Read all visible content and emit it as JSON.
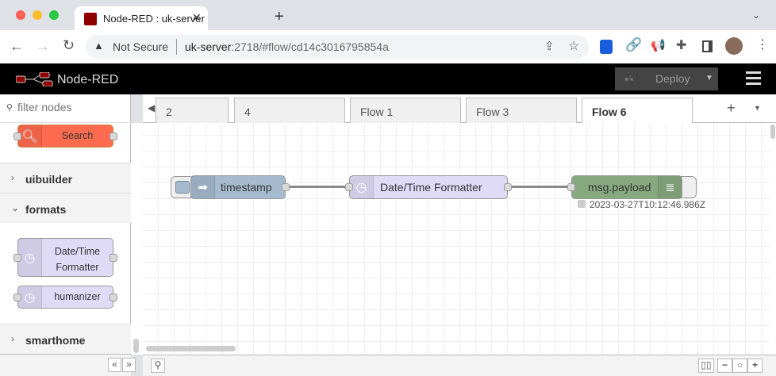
{
  "browser": {
    "tab_title": "Node-RED : uk-server",
    "security": "Not Secure",
    "url_host": "uk-server",
    "url_rest": ":2718/#flow/cd14c3016795854a"
  },
  "header": {
    "app_title": "Node-RED",
    "deploy_label": "Deploy"
  },
  "palette": {
    "filter_placeholder": "filter nodes",
    "categories": [
      {
        "label": "uibuilder",
        "expanded": false
      },
      {
        "label": "formats",
        "expanded": true
      },
      {
        "label": "smarthome",
        "expanded": false
      }
    ],
    "nodes": {
      "search": "Search",
      "datetime_line1": "Date/Time",
      "datetime_line2": "Formatter",
      "humanizer": "humanizer"
    }
  },
  "workspace": {
    "tabs": [
      {
        "label": "2"
      },
      {
        "label": "4"
      },
      {
        "label": "Flow 1"
      },
      {
        "label": "Flow 3"
      },
      {
        "label": "Flow 6",
        "active": true
      }
    ]
  },
  "flow": {
    "nodes": [
      {
        "label": "timestamp",
        "color": "#a6bbcf"
      },
      {
        "label": "Date/Time Formatter",
        "color": "#dfdbf7"
      },
      {
        "label": "msg.payload",
        "color": "#87a980"
      }
    ],
    "debug_status": "2023-03-27T10:12:46.986Z"
  }
}
